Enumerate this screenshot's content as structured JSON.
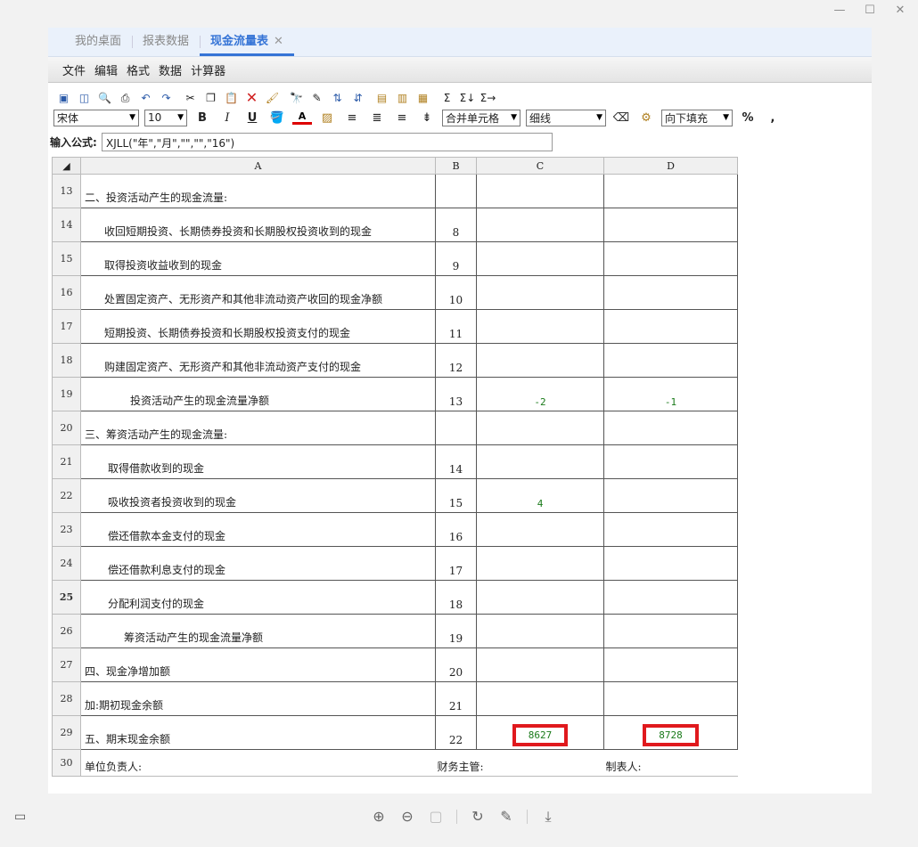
{
  "tabs": [
    {
      "label": "我的桌面",
      "active": false
    },
    {
      "label": "报表数据",
      "active": false
    },
    {
      "label": "现金流量表",
      "active": true
    }
  ],
  "menu": [
    "文件",
    "编辑",
    "格式",
    "数据",
    "计算器"
  ],
  "toolbar": {
    "font": "宋体",
    "size": "10",
    "bold": "B",
    "italic": "I",
    "underline": "U",
    "font_color": "A",
    "merge": "合并单元格",
    "border": "细线",
    "fill": "向下填充",
    "percent": "%",
    "comma": ","
  },
  "formula": {
    "label": "输入公式:",
    "value": "XJLL(\"年\",\"月\",\"\",\"\",\"16\")"
  },
  "columns": [
    "A",
    "B",
    "C",
    "D"
  ],
  "rows": [
    {
      "num": "13",
      "a": "二、投资活动产生的现金流量:",
      "b": "",
      "c": "",
      "d": ""
    },
    {
      "num": "14",
      "a": "收回短期投资、长期债券投资和长期股权投资收到的现金",
      "b": "8",
      "c": "",
      "d": ""
    },
    {
      "num": "15",
      "a": "取得投资收益收到的现金",
      "b": "9",
      "c": "",
      "d": ""
    },
    {
      "num": "16",
      "a": "处置固定资产、无形资产和其他非流动资产收回的现金净额",
      "b": "10",
      "c": "",
      "d": ""
    },
    {
      "num": "17",
      "a": "短期投资、长期债券投资和长期股权投资支付的现金",
      "b": "11",
      "c": "",
      "d": ""
    },
    {
      "num": "18",
      "a": "购建固定资产、无形资产和其他非流动资产支付的现金",
      "b": "12",
      "c": "",
      "d": ""
    },
    {
      "num": "19",
      "a": "投资活动产生的现金流量净额",
      "b": "13",
      "c": "-2",
      "d": "-1"
    },
    {
      "num": "20",
      "a": "三、筹资活动产生的现金流量:",
      "b": "",
      "c": "",
      "d": ""
    },
    {
      "num": "21",
      "a": "取得借款收到的现金",
      "b": "14",
      "c": "",
      "d": ""
    },
    {
      "num": "22",
      "a": "吸收投资者投资收到的现金",
      "b": "15",
      "c": "4",
      "d": ""
    },
    {
      "num": "23",
      "a": "偿还借款本金支付的现金",
      "b": "16",
      "c": "",
      "d": ""
    },
    {
      "num": "24",
      "a": "偿还借款利息支付的现金",
      "b": "17",
      "c": "",
      "d": ""
    },
    {
      "num": "25",
      "a": "分配利润支付的现金",
      "b": "18",
      "c": "",
      "d": ""
    },
    {
      "num": "26",
      "a": "筹资活动产生的现金流量净额",
      "b": "19",
      "c": "",
      "d": ""
    },
    {
      "num": "27",
      "a": "四、现金净增加额",
      "b": "20",
      "c": "",
      "d": ""
    },
    {
      "num": "28",
      "a": "加:期初现金余额",
      "b": "21",
      "c": "",
      "d": ""
    },
    {
      "num": "29",
      "a": "五、期末现金余额",
      "b": "22",
      "c": "8627",
      "d": "8728"
    }
  ],
  "footer": {
    "num": "30",
    "a": "单位负责人:",
    "b": "财务主管:",
    "d": "制表人:"
  },
  "colors": {
    "accent": "#3574d6",
    "highlight": "#e0191d",
    "value_green": "#1a7a1a"
  }
}
